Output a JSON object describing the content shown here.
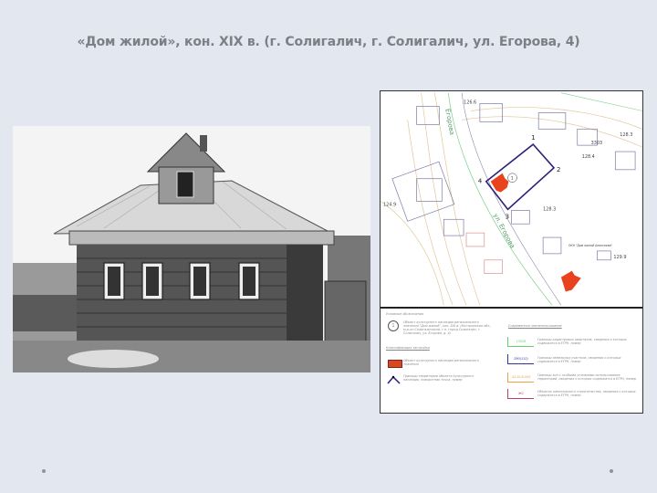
{
  "title": "«Дом жилой», кон. XIX в. (г. Солигалич, г. Солигалич, ул. Егорова, 4)",
  "map": {
    "street_label": "ул. Егорова",
    "street_label_top": "Егорова",
    "okn_label": "ОКН \"Дом жилой Алексеева\"",
    "elevations": [
      "126.6",
      "128.3",
      "128.4",
      "124.9",
      "129.9",
      "128.3"
    ],
    "parcel_number": "3303",
    "point_labels": [
      "1",
      "2",
      "3",
      "4"
    ],
    "object_marker": "1"
  },
  "legend": {
    "heading": "Условные обозначения",
    "object_desc": "Объект культурного наследия регионального значения \"Дом жилой\", кон. XIX в. (Костромская обл., м-р-он Солигаличский, г.п. город Солигалич, г. Солигалич, ул. Егорова, д. 4)",
    "classification_heading": "Классификация застройки",
    "red_desc": "Объект культурного наследия регионального значения",
    "boundary_desc": "Границы территории объекта культурного наследия, поворотная точка, номер",
    "current_heading": "Современное землепользование",
    "items": [
      {
        "code": "13026",
        "desc": "Границы кадастровых кварталов, сведения о которых содержатся в ЕГРН, номер",
        "color": "#5fcf6a"
      },
      {
        "code": "290(112)",
        "desc": "Границы земельных участков, сведения о которых содержатся в ЕГРН, номер",
        "color": "#333399"
      },
      {
        "code": "44.20.6.508",
        "desc": "Границы зон с особыми условиями использования территорий, сведения о которых содержатся в ЕГРН, номер",
        "color": "#f0a040"
      },
      {
        "code": "ЖС",
        "desc": "Объекты капитального строительства, сведения о которых содержатся в ЕГРН, номер",
        "color": "#c04060"
      }
    ]
  }
}
